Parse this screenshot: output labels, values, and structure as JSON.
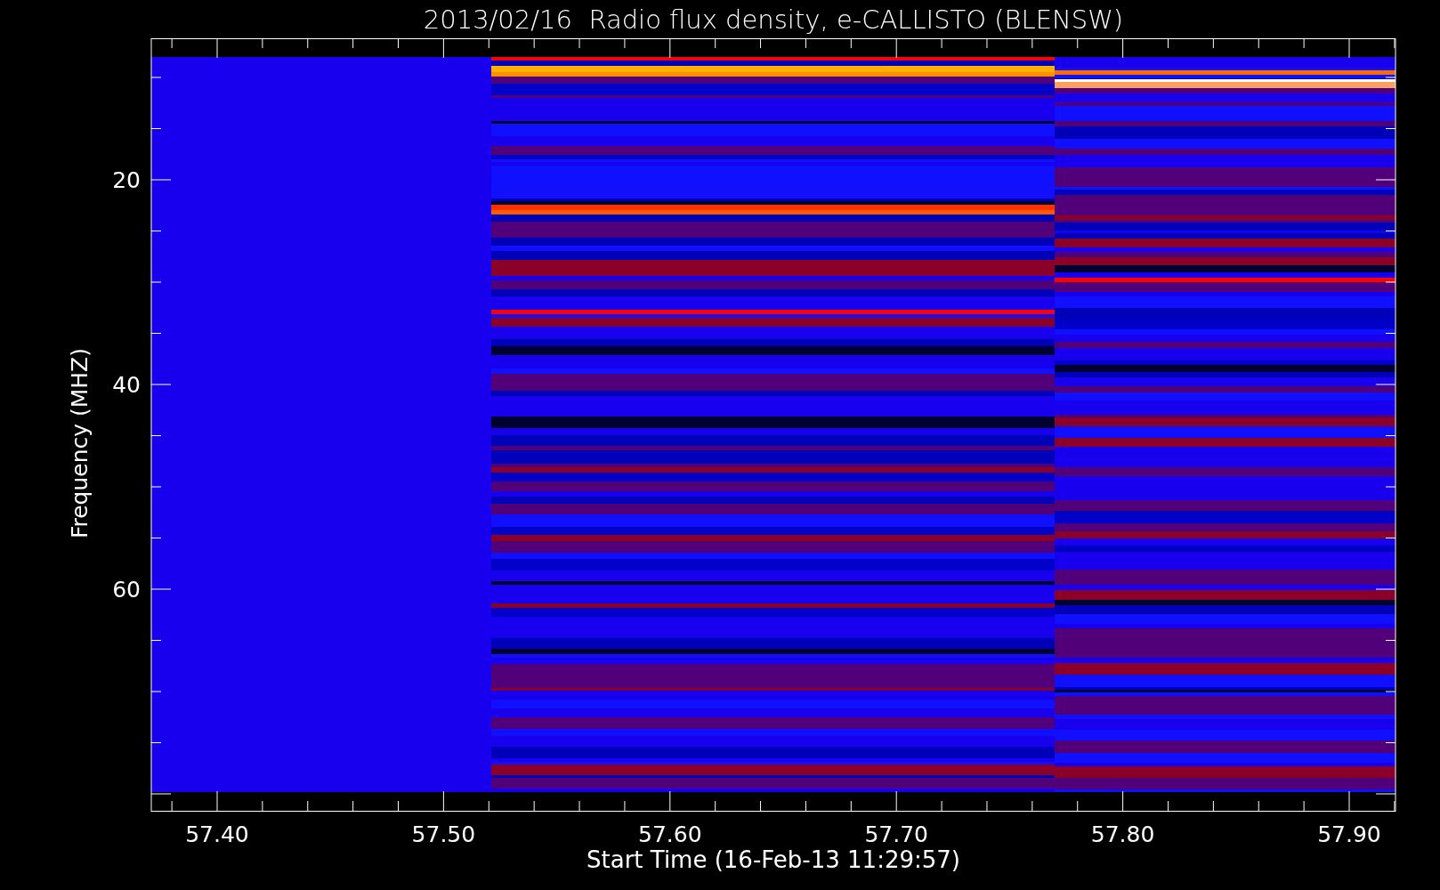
{
  "title": "2013/02/16  Radio flux density, e-CALLISTO (BLENSW)",
  "y_axis": {
    "label": "Frequency (MHZ)",
    "ticks": [
      "20",
      "40",
      "60"
    ]
  },
  "x_axis": {
    "label": "Start Time (16-Feb-13 11:29:57)",
    "ticks": [
      "57.40",
      "57.50",
      "57.60",
      "57.70",
      "57.80",
      "57.90"
    ]
  }
}
